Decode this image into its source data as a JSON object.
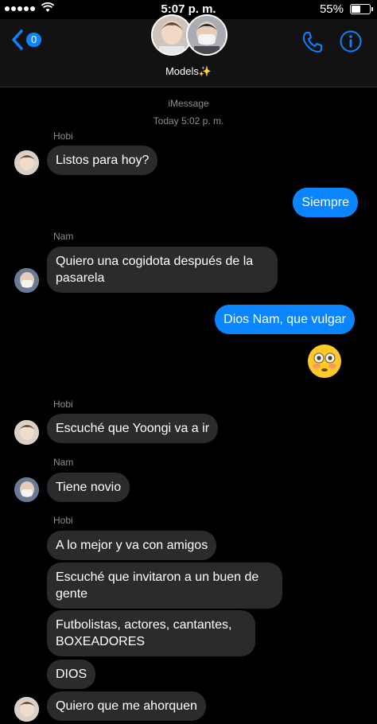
{
  "status_bar": {
    "time": "5:07 p. m.",
    "battery_pct_text": "55%",
    "battery_level": 0.55
  },
  "header": {
    "badge_count": "0",
    "title": "Models✨"
  },
  "thread": {
    "service": "iMessage",
    "timestamp": "Today 5:02 p. m."
  },
  "messages": [
    {
      "sender": "Hobi",
      "text": "Listos para hoy?"
    },
    {
      "text": "Siempre"
    },
    {
      "sender": "Nam",
      "text": "Quiero una cogidota después de la pasarela"
    },
    {
      "text": "Dios Nam, que vulgar"
    },
    {
      "emoji": "flushed-face"
    },
    {
      "sender": "Hobi",
      "text": "Escuché que Yoongi va a ir"
    },
    {
      "sender": "Nam",
      "text": "Tiene novio"
    },
    {
      "sender": "Hobi",
      "text": "A lo mejor y va con amigos"
    },
    {
      "text": "Escuché que invitaron a un buen de gente"
    },
    {
      "text": "Futbolistas, actores, cantantes, BOXEADORES"
    },
    {
      "text": "DIOS"
    },
    {
      "text": "Quiero que me ahorquen"
    }
  ],
  "colors": {
    "accent": "#0a84ff",
    "incoming_bubble": "#2b2b2d",
    "background": "#000000"
  }
}
